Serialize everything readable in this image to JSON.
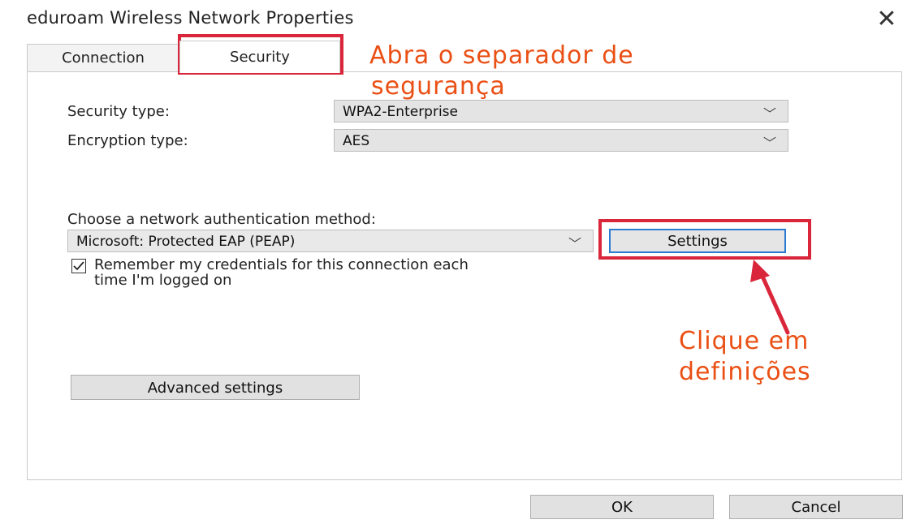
{
  "window": {
    "title": "eduroam Wireless Network Properties",
    "close_glyph": "✕"
  },
  "tabs": [
    {
      "label": "Connection",
      "selected": false
    },
    {
      "label": "Security",
      "selected": true
    }
  ],
  "security": {
    "security_type_label": "Security type:",
    "security_type_value": "WPA2-Enterprise",
    "encryption_type_label": "Encryption type:",
    "encryption_type_value": "AES",
    "auth_method_label": "Choose a network authentication method:",
    "auth_method_value": "Microsoft: Protected EAP (PEAP)",
    "settings_button": "Settings",
    "remember_checked": true,
    "remember_line1": "Remember my credentials for this connection each",
    "remember_line2": "time I'm logged on",
    "advanced_button": "Advanced settings"
  },
  "footer": {
    "ok_button": "OK",
    "cancel_button": "Cancel"
  },
  "annotations": {
    "open_tab_line1": "Abra o separador de",
    "open_tab_line2": "segurança",
    "click_line1": "Clique em",
    "click_line2": "definições",
    "highlight_color": "#d9263b",
    "text_color": "#ea4f14"
  },
  "icons": {
    "chevron": "chevron-down-icon",
    "checkbox": "checkmark-icon",
    "arrow": "arrow-up-icon"
  }
}
